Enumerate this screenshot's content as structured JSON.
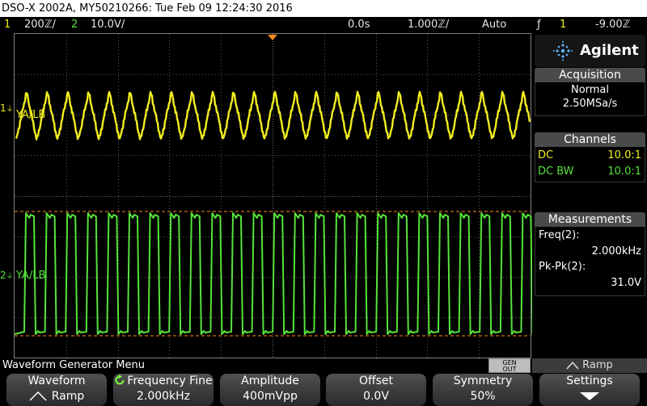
{
  "title_bar": "DSO-X 2002A, MY50210266: Tue Feb 09 12:24:30 2016",
  "status": {
    "ch1_num": "1",
    "ch1_scale": "200ℤ/",
    "ch2_num": "2",
    "ch2_scale": "10.0V/",
    "delay": "0.0s",
    "timebase": "1.000ℤ/",
    "trigger_mode": "Auto",
    "trigger_icon": "ƒ",
    "trigger_channel": "1",
    "trigger_level": "-9.00ℤ"
  },
  "waveform": {
    "ch1_marker": "1",
    "ch1_ground": "⏚",
    "ch1_label": "YA/LB",
    "ch2_marker": "2",
    "ch2_ground": "⏚",
    "ch2_label": "YA/LB",
    "ch1_color": "#f2ee1f",
    "ch2_color": "#56e33b"
  },
  "side": {
    "brand": "Agilent",
    "acquisition_header": "Acquisition",
    "acquisition_mode": "Normal",
    "acquisition_rate": "2.50MSa/s",
    "channels_header": "Channels",
    "ch1_coupling": "DC",
    "ch1_probe": "10.0:1",
    "ch2_coupling": "DC BW",
    "ch2_probe": "10.0:1",
    "measurements_header": "Measurements",
    "meas1_label": "Freq(2):",
    "meas1_value": "2.000kHz",
    "meas2_label": "Pk-Pk(2):",
    "meas2_value": "31.0V"
  },
  "menu": {
    "title": "Waveform Generator Menu",
    "gen_line1": "GEN",
    "gen_line2": "OUT",
    "ramp_tag": "Ramp"
  },
  "softkeys": [
    {
      "label": "Waveform",
      "value": "Ramp"
    },
    {
      "label": "Frequency Fine",
      "value": "2.000kHz"
    },
    {
      "label": "Amplitude",
      "value": "400mVpp"
    },
    {
      "label": "Offset",
      "value": "0.0V"
    },
    {
      "label": "Symmetry",
      "value": "50%"
    },
    {
      "label": "Settings",
      "value": ""
    }
  ]
}
